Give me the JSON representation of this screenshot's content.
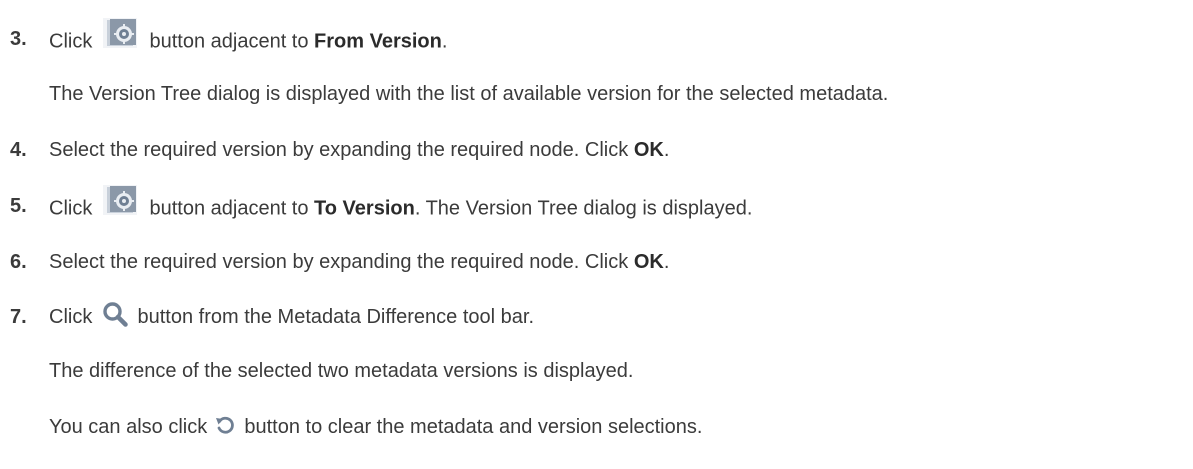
{
  "steps": [
    {
      "num": "3.",
      "pre": "Click",
      "post": "button adjacent to",
      "bold": "From Version",
      "end": "."
    },
    {
      "sub": "The Version Tree dialog is displayed with the list of available version for the selected metadata."
    },
    {
      "num": "4.",
      "pre": "Select the required version by expanding the required node. Click",
      "bold": "OK",
      "end": "."
    },
    {
      "num": "5.",
      "pre": "Click",
      "post": "button adjacent to",
      "bold": "To Version",
      "end": ". The Version Tree dialog is displayed."
    },
    {
      "num": "6.",
      "pre": "Select the required version by expanding the required node. Click",
      "bold": "OK",
      "end": "."
    },
    {
      "num": "7.",
      "pre": "Click",
      "post": "button from the Metadata Difference tool bar."
    },
    {
      "sub": "The difference of the selected two metadata versions is displayed."
    },
    {
      "sub_pre": "You can also click",
      "sub_post": "button to clear the metadata and version selections."
    }
  ],
  "icons": {
    "version": "version-tree-icon",
    "search": "search-icon",
    "reset": "reset-icon",
    "accent": "#6f7f93"
  }
}
